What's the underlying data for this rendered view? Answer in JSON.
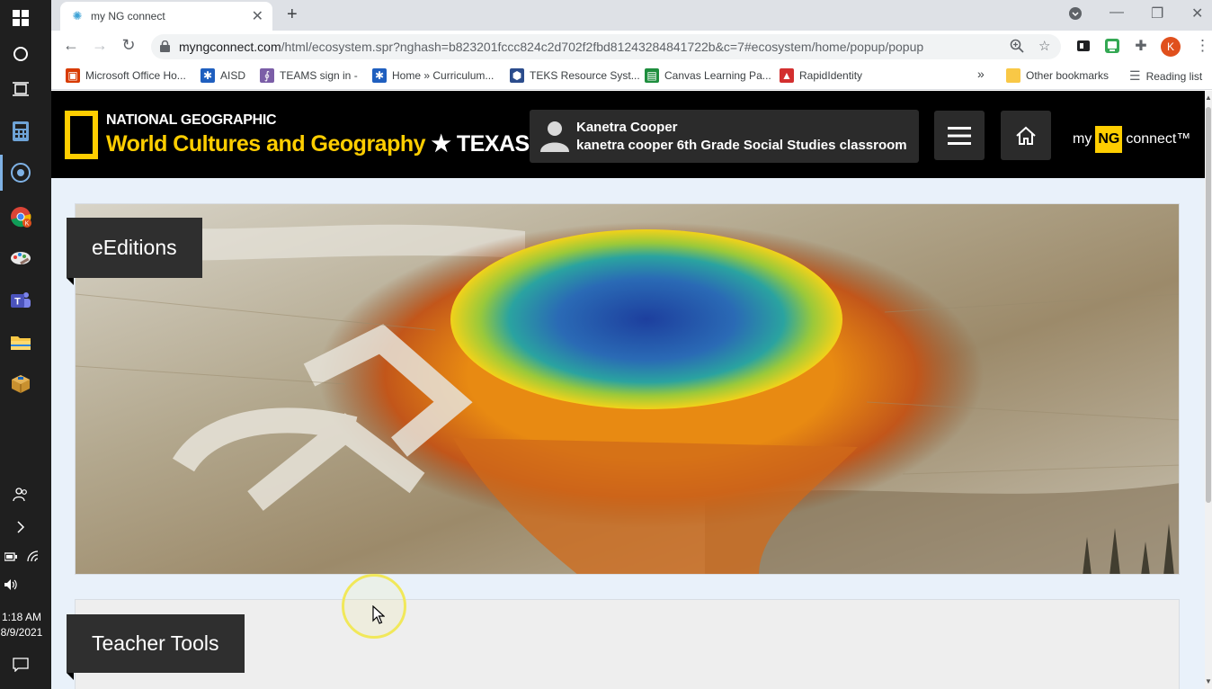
{
  "taskbar": {
    "time": "1:18 AM",
    "date": "8/9/2021",
    "icons": [
      "windows-start-icon",
      "search-circle-icon",
      "task-view-icon",
      "calculator-icon",
      "cortana-icon",
      "chrome-icon",
      "paint-icon",
      "teams-icon",
      "file-explorer-icon",
      "package-icon",
      "people-icon",
      "chevron-right-icon",
      "battery-icon",
      "wifi-icon",
      "speaker-icon",
      "notification-icon"
    ]
  },
  "browser": {
    "tab_title": "my NG connect",
    "url_host": "myngconnect.com",
    "url_path": "/html/ecosystem.spr?nghash=b823201fccc824c2d702f2fbd81243284841722b&c=7#ecosystem/home/popup/popup",
    "bookmarks": [
      {
        "label": "Microsoft Office Ho...",
        "color": "#d83b01",
        "glyph": "▣"
      },
      {
        "label": "AISD",
        "color": "#1f5fbf",
        "glyph": "✱"
      },
      {
        "label": "TEAMS sign in -",
        "color": "#7b5ea7",
        "glyph": "∮"
      },
      {
        "label": "Home » Curriculum...",
        "color": "#1f5fbf",
        "glyph": "✱"
      },
      {
        "label": "TEKS Resource Syst...",
        "color": "#2b4c8c",
        "glyph": "⬢"
      },
      {
        "label": "Canvas Learning Pa...",
        "color": "#1e8e3e",
        "glyph": "▤"
      },
      {
        "label": "RapidIdentity",
        "color": "#d32f2f",
        "glyph": "▲"
      }
    ],
    "more_bookmarks": "»",
    "other_bookmarks": "Other bookmarks",
    "reading_list": "Reading list",
    "profile_initial": "K"
  },
  "header": {
    "brand": "NATIONAL GEOGRAPHIC",
    "title_part1": "World Cultures and Geography",
    "title_star": "★",
    "title_part2": "TEXAS",
    "user_name": "Kanetra Cooper",
    "user_class": "kanetra cooper 6th Grade Social Studies classroom",
    "logo_my": "my",
    "logo_ng": "NG",
    "logo_connect": "connect™"
  },
  "sections": [
    {
      "label": "eEditions"
    },
    {
      "label": "Teacher Tools"
    }
  ]
}
